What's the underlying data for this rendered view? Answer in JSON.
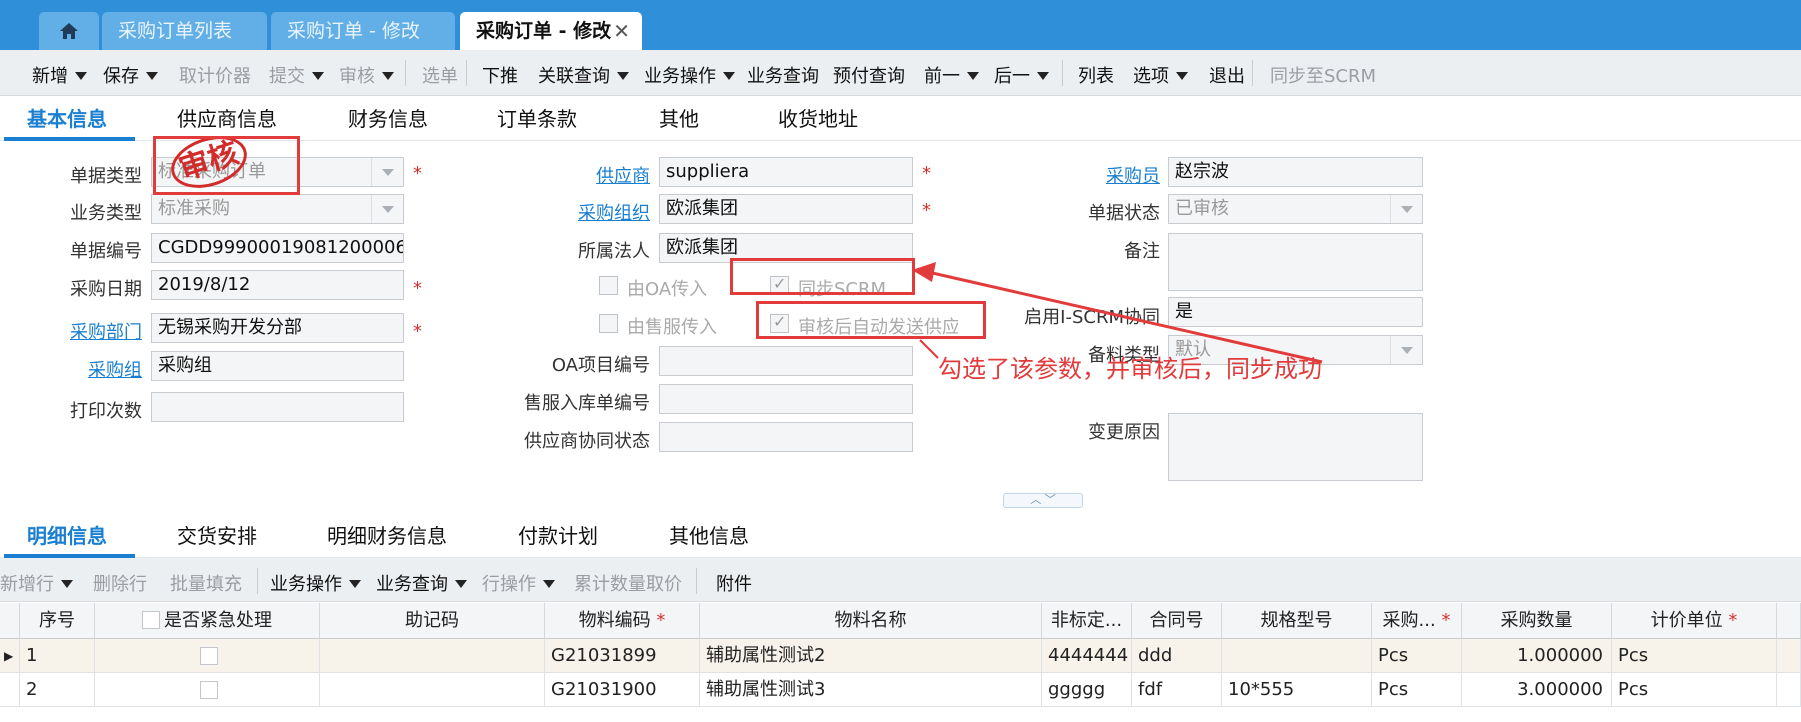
{
  "tabs": [
    "采购订单列表",
    "采购订单 - 修改",
    "采购订单 - 修改"
  ],
  "toolbar": {
    "new": "新增",
    "save": "保存",
    "price": "取计价器",
    "submit": "提交",
    "audit": "审核",
    "select": "选单",
    "push": "下推",
    "linkquery": "关联查询",
    "bizop": "业务操作",
    "bizquery": "业务查询",
    "prepaid": "预付查询",
    "prev": "前一",
    "next": "后一",
    "list": "列表",
    "options": "选项",
    "exit": "退出",
    "sync": "同步至SCRM"
  },
  "section_tabs": [
    "基本信息",
    "供应商信息",
    "财务信息",
    "订单条款",
    "其他",
    "收货地址"
  ],
  "form": {
    "doc_type_label": "单据类型",
    "doc_type_value": "标准采购订单",
    "biz_type_label": "业务类型",
    "biz_type_value": "标准采购",
    "doc_no_label": "单据编号",
    "doc_no_value": "CGDD99900019081200006",
    "date_label": "采购日期",
    "date_value": "2019/8/12",
    "dept_label": "采购部门",
    "dept_value": "无锡采购开发分部",
    "group_label": "采购组",
    "group_value": "采购组",
    "print_label": "打印次数",
    "print_value": "",
    "supplier_label": "供应商",
    "supplier_value": "suppliera",
    "org_label": "采购组织",
    "org_value": "欧派集团",
    "legal_label": "所属法人",
    "legal_value": "欧派集团",
    "oa_in": "由OA传入",
    "sync_scrm": "同步SCRM",
    "sale_in": "由售服传入",
    "auto_send": "审核后自动发送供应",
    "oa_proj_label": "OA项目编号",
    "oa_proj_value": "",
    "stock_label": "售服入库单编号",
    "stock_value": "",
    "collab_label": "供应商协同状态",
    "collab_value": "",
    "buyer_label": "采购员",
    "buyer_value": "赵宗波",
    "status_label": "单据状态",
    "status_value": "已审核",
    "remark_label": "备注",
    "remark_value": "",
    "iscrm_label": "启用I-SCRM协同",
    "iscrm_value": "是",
    "material_type_label": "备料类型",
    "material_type_value": "默认",
    "change_label": "变更原因",
    "change_value": ""
  },
  "stamp": "审核",
  "annotation": "勾选了该参数，并审核后，同步成功",
  "detail_tabs": [
    "明细信息",
    "交货安排",
    "明细财务信息",
    "付款计划",
    "其他信息"
  ],
  "detail_toolbar": {
    "addrow": "新增行",
    "delrow": "删除行",
    "batch": "批量填充",
    "bizop": "业务操作",
    "bizquery": "业务查询",
    "rowop": "行操作",
    "cumqty": "累计数量取价",
    "attach": "附件"
  },
  "grid": {
    "headers": [
      "序号",
      "是否紧急处理",
      "助记码",
      "物料编码",
      "物料名称",
      "非标定...",
      "合同号",
      "规格型号",
      "采购...",
      "采购数量",
      "计价单位"
    ],
    "rows": [
      [
        "1",
        "",
        "",
        "G21031899",
        "辅助属性测试2",
        "4444444",
        "ddd",
        "",
        "Pcs",
        "1.000000",
        "Pcs"
      ],
      [
        "2",
        "",
        "",
        "G21031900",
        "辅助属性测试3",
        "ggggg",
        "fdf",
        "10*555",
        "Pcs",
        "3.000000",
        "Pcs"
      ]
    ]
  }
}
